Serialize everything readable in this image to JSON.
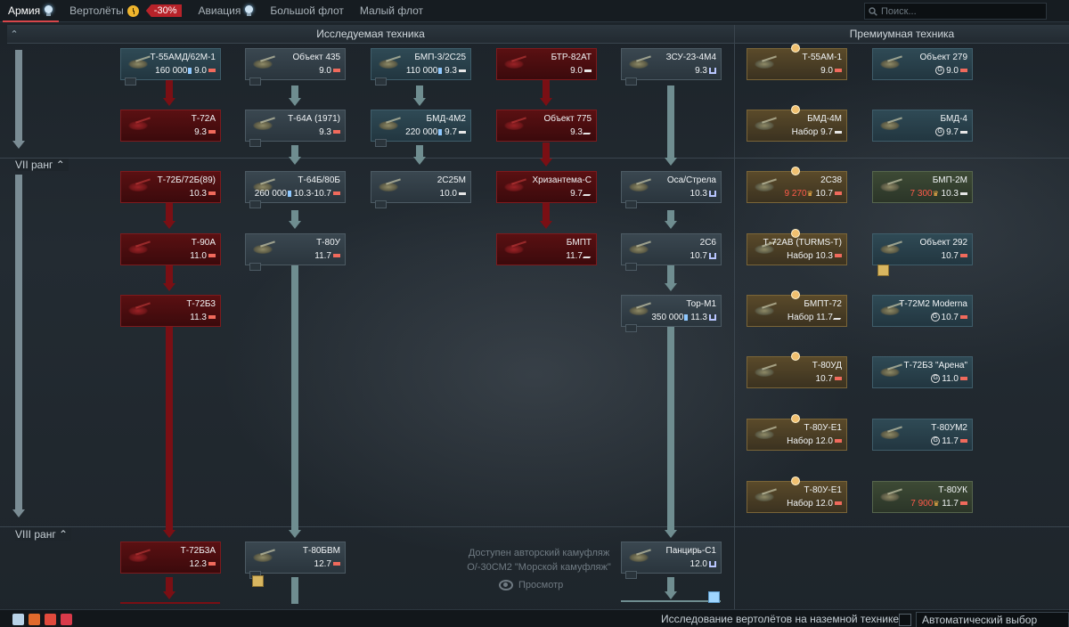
{
  "tabs": [
    {
      "label": "Армия",
      "active": true,
      "icon": "bulb-icon"
    },
    {
      "label": "Вертолёты",
      "icon": "clock-icon",
      "discount": "-30%"
    },
    {
      "label": "Авиация",
      "icon": "bulb-icon"
    },
    {
      "label": "Большой флот"
    },
    {
      "label": "Малый флот"
    }
  ],
  "search": {
    "placeholder": "Поиск..."
  },
  "sections": {
    "researchable": "Исследуемая техника",
    "premium": "Премиумная техника"
  },
  "ranks": {
    "vii": "VII ранг",
    "viii": "VIII ранг"
  },
  "colors": {
    "accent": "#d8464a",
    "researched_red": "#7a0f14",
    "connector": "#6f8d90"
  },
  "tree": [
    {
      "id": "t55amd",
      "name": "Т-55АМД/62М-1",
      "cost": "160 000",
      "br": "9.0",
      "style": "prem",
      "role": "heavy"
    },
    {
      "id": "obj435",
      "name": "Объект 435",
      "cost": "",
      "br": "9.0",
      "style": "normal",
      "role": "heavy"
    },
    {
      "id": "bmp3",
      "name": "БМП-3/2С25",
      "cost": "110 000",
      "br": "9.3",
      "style": "prem",
      "role": "light"
    },
    {
      "id": "btr82at",
      "name": "БТР-82АТ",
      "cost": "",
      "br": "9.0",
      "style": "red",
      "role": "light"
    },
    {
      "id": "zsu234m4",
      "name": "ЗСУ-23-4М4",
      "cost": "",
      "br": "9.3",
      "style": "normal",
      "role": "aa"
    },
    {
      "id": "t72a",
      "name": "Т-72А",
      "cost": "",
      "br": "9.3",
      "style": "red",
      "role": "heavy"
    },
    {
      "id": "t64a",
      "name": "Т-64А (1971)",
      "cost": "",
      "br": "9.3",
      "style": "normal",
      "role": "heavy"
    },
    {
      "id": "bmd4m2",
      "name": "БМД-4М2",
      "cost": "220 000",
      "br": "9.7",
      "style": "prem",
      "role": "light"
    },
    {
      "id": "obj775",
      "name": "Объект 775",
      "cost": "",
      "br": "9.3",
      "style": "red",
      "role": "spg"
    },
    {
      "id": "t72b",
      "name": "Т-72Б/72Б(89)",
      "cost": "",
      "br": "10.3",
      "style": "red",
      "role": "heavy"
    },
    {
      "id": "t64b",
      "name": "Т-64Б/80Б",
      "cost": "260 000",
      "br": "10.3-10.7",
      "style": "normal",
      "role": "heavy"
    },
    {
      "id": "2s25m",
      "name": "2С25М",
      "cost": "",
      "br": "10.0",
      "style": "normal",
      "role": "light"
    },
    {
      "id": "khrizantema",
      "name": "Хризантема-С",
      "cost": "",
      "br": "9.7",
      "style": "red",
      "role": "spg"
    },
    {
      "id": "osa",
      "name": "Оса/Стрела",
      "cost": "",
      "br": "10.3",
      "style": "normal",
      "role": "aa"
    },
    {
      "id": "t90a",
      "name": "Т-90А",
      "cost": "",
      "br": "11.0",
      "style": "red",
      "role": "heavy"
    },
    {
      "id": "t80u",
      "name": "Т-80У",
      "cost": "",
      "br": "11.7",
      "style": "normal",
      "role": "heavy"
    },
    {
      "id": "bmpt",
      "name": "БМПТ",
      "cost": "",
      "br": "11.7",
      "style": "red",
      "role": "spg"
    },
    {
      "id": "2s6",
      "name": "2С6",
      "cost": "",
      "br": "10.7",
      "style": "normal",
      "role": "aa"
    },
    {
      "id": "t72b3",
      "name": "Т-72Б3",
      "cost": "",
      "br": "11.3",
      "style": "red",
      "role": "heavy"
    },
    {
      "id": "torm1",
      "name": "Тор-М1",
      "cost": "350 000",
      "br": "11.3",
      "style": "normal",
      "role": "aa"
    },
    {
      "id": "t72b3a",
      "name": "Т-72Б3А",
      "cost": "",
      "br": "12.3",
      "style": "red",
      "role": "heavy"
    },
    {
      "id": "t80bvm",
      "name": "Т-80БВМ",
      "cost": "",
      "br": "12.7",
      "style": "normal",
      "role": "heavy"
    },
    {
      "id": "pantsir",
      "name": "Панцирь-С1",
      "cost": "",
      "br": "12.0",
      "style": "normal",
      "role": "aa"
    }
  ],
  "premium": [
    {
      "id": "t55am1",
      "name": "Т-55АМ-1",
      "price": "",
      "br": "9.0",
      "style": "gold",
      "role": "heavy"
    },
    {
      "id": "obj279",
      "name": "Объект 279",
      "price": "ge",
      "br": "9.0",
      "style": "prem",
      "role": "heavy-red"
    },
    {
      "id": "bmd4m",
      "name": "БМД-4М",
      "price": "Набор",
      "br": "9.7",
      "style": "gold",
      "role": "light"
    },
    {
      "id": "bmd4",
      "name": "БМД-4",
      "price": "ge",
      "br": "9.7",
      "style": "prem",
      "role": "light"
    },
    {
      "id": "2s38",
      "name": "2С38",
      "price": "9 270",
      "br": "10.7",
      "style": "gold",
      "role": "heavy"
    },
    {
      "id": "bmp2m",
      "name": "БМП-2М",
      "price": "7 300",
      "br": "10.3",
      "style": "greenish",
      "role": "light"
    },
    {
      "id": "t72av",
      "name": "Т-72АВ (TURMS-T)",
      "price": "Набор",
      "br": "10.3",
      "style": "gold",
      "role": "heavy"
    },
    {
      "id": "obj292",
      "name": "Объект 292",
      "price": "",
      "br": "10.7",
      "style": "prem",
      "role": "heavy"
    },
    {
      "id": "bmpt72",
      "name": "БМПТ-72",
      "price": "Набор",
      "br": "11.7",
      "style": "gold",
      "role": "spg"
    },
    {
      "id": "t72m2",
      "name": "Т-72М2 Moderna",
      "price": "ge",
      "br": "10.7",
      "style": "prem",
      "role": "heavy"
    },
    {
      "id": "t80ud",
      "name": "Т-80УД",
      "price": "",
      "br": "10.7",
      "style": "gold",
      "role": "heavy"
    },
    {
      "id": "t72b3arena",
      "name": "Т-72Б3 \"Арена\"",
      "price": "ge",
      "br": "11.0",
      "style": "prem",
      "role": "heavy"
    },
    {
      "id": "t80ue1",
      "name": "Т-80У-Е1",
      "price": "Набор",
      "br": "12.0",
      "style": "gold",
      "role": "heavy"
    },
    {
      "id": "t80um2",
      "name": "Т-80УМ2",
      "price": "ge",
      "br": "11.7",
      "style": "prem",
      "role": "heavy"
    },
    {
      "id": "t80ue1b",
      "name": "Т-80У-Е1",
      "price": "Набор",
      "br": "12.0",
      "style": "gold",
      "role": "heavy"
    },
    {
      "id": "t80uk",
      "name": "Т-80УК",
      "price": "7 900",
      "br": "11.7",
      "style": "greenish",
      "role": "heavy"
    }
  ],
  "notice": {
    "line1": "Доступен авторский камуфляж",
    "line2": "О/-30СМ2 \"Морской камуфляж\"",
    "view": "Просмотр"
  },
  "bottom": {
    "heli_research": "Исследование вертолётов на наземной технике",
    "auto_select": "Автоматический выбор"
  }
}
